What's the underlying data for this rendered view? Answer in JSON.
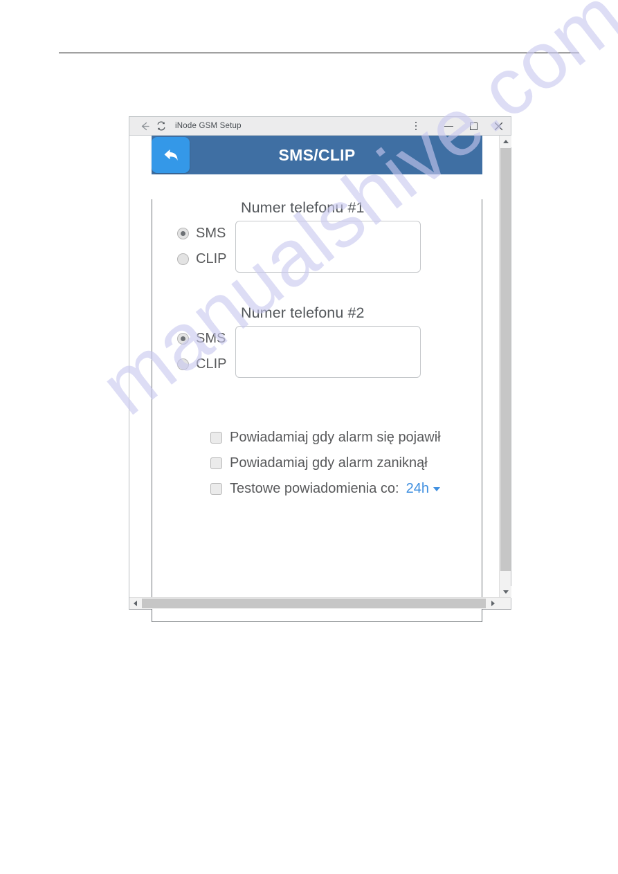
{
  "window": {
    "title": "iNode GSM Setup",
    "back_nav_icon": "back-arrow-icon",
    "reload_icon": "refresh-icon",
    "menu_icon": "kebab-menu-icon",
    "minimize_label": "minimize",
    "maximize_label": "maximize",
    "close_label": "close"
  },
  "app": {
    "header": {
      "title": "SMS/CLIP",
      "back_button_icon": "back-arrow-icon",
      "bar_color": "#3f6fa3",
      "back_button_color": "#3498e8"
    },
    "phone_groups": [
      {
        "label": "Numer telefonu #1",
        "options": [
          {
            "label": "SMS",
            "selected": true
          },
          {
            "label": "CLIP",
            "selected": false
          }
        ],
        "value": "",
        "placeholder": ""
      },
      {
        "label": "Numer telefonu #2",
        "options": [
          {
            "label": "SMS",
            "selected": true
          },
          {
            "label": "CLIP",
            "selected": false
          }
        ],
        "value": "",
        "placeholder": ""
      }
    ],
    "checkboxes": [
      {
        "label": "Powiadamiaj gdy alarm się pojawił",
        "checked": false
      },
      {
        "label": "Powiadamiaj gdy alarm zaniknął",
        "checked": false
      },
      {
        "label": "Testowe powiadomienia co:",
        "checked": false,
        "interval": "24h",
        "interval_color": "#3f8fe0"
      }
    ]
  },
  "watermark": {
    "text": "manualshive.com"
  }
}
